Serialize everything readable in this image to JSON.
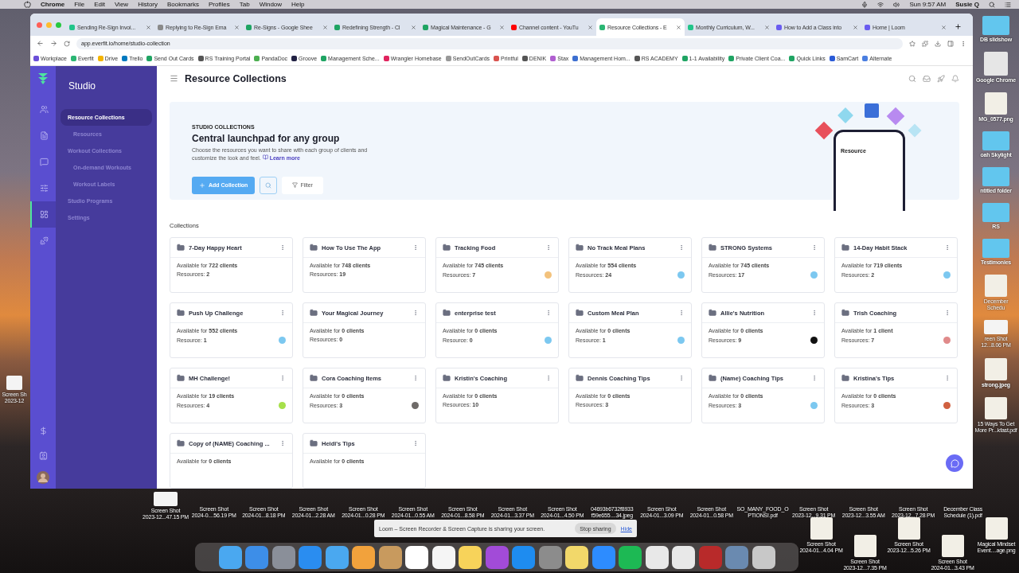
{
  "menubar": {
    "app": "Chrome",
    "menus": [
      "File",
      "Edit",
      "View",
      "History",
      "Bookmarks",
      "Profiles",
      "Tab",
      "Window",
      "Help"
    ],
    "clock": "Sun 9:57 AM",
    "user": "Susie Q"
  },
  "browser": {
    "tabs": [
      {
        "title": "Sending Re-Sign Invoi...",
        "color": "#22c58a",
        "selected": false
      },
      {
        "title": "Replying to Re-Sign Ema",
        "color": "#8a8a8a",
        "selected": false
      },
      {
        "title": "Re-Signs - Google Shee",
        "color": "#1fa463",
        "selected": false
      },
      {
        "title": "Redefining Strength - Cl",
        "color": "#1fa463",
        "selected": false
      },
      {
        "title": "Magical Maintenance - G",
        "color": "#1fa463",
        "selected": false
      },
      {
        "title": "Channel content - YouTu",
        "color": "#ff0000",
        "selected": false
      },
      {
        "title": "Resource Collections - E",
        "color": "#2bb673",
        "selected": true
      },
      {
        "title": "Monthly Curriculum, W...",
        "color": "#22c58a",
        "selected": false
      },
      {
        "title": "How to Add a Class into",
        "color": "#6a5cf0",
        "selected": false
      },
      {
        "title": "Home | Loom",
        "color": "#6a5cf0",
        "selected": false
      }
    ],
    "address": "app.everfit.io/home/studio-collection",
    "bookmarks": [
      {
        "label": "Workplace",
        "color": "#6b4fd8"
      },
      {
        "label": "Everfit",
        "color": "#2bb673"
      },
      {
        "label": "Drive",
        "color": "#f4b400"
      },
      {
        "label": "Trello",
        "color": "#0079bf"
      },
      {
        "label": "Send Out Cards",
        "color": "#1fa463"
      },
      {
        "label": "RS Training Portal",
        "color": "#555555"
      },
      {
        "label": "PandaDoc",
        "color": "#4caf50"
      },
      {
        "label": "Groove",
        "color": "#222244"
      },
      {
        "label": "Management Sche...",
        "color": "#1fa463"
      },
      {
        "label": "Wrangler Homebase",
        "color": "#e0245e"
      },
      {
        "label": "SendOutCards",
        "color": "#999999"
      },
      {
        "label": "Printful",
        "color": "#d9534f"
      },
      {
        "label": "DENIK",
        "color": "#555555"
      },
      {
        "label": "Stax",
        "color": "#b05fd0"
      },
      {
        "label": "Management Hom...",
        "color": "#3d6fd0"
      },
      {
        "label": "RS ACADEMY",
        "color": "#555555"
      },
      {
        "label": "1-1 Availability",
        "color": "#1fa463"
      },
      {
        "label": "Private Client Coa...",
        "color": "#1fa463"
      },
      {
        "label": "Quick Links",
        "color": "#1fa463"
      },
      {
        "label": "SamCart",
        "color": "#2a5bd7"
      },
      {
        "label": "Alternate",
        "color": "#4a7ee0"
      }
    ]
  },
  "app": {
    "rail": [
      {
        "selected": false
      },
      {
        "selected": false
      },
      {
        "selected": false
      },
      {
        "selected": false
      },
      {
        "selected": true
      },
      {
        "selected": false
      }
    ],
    "section": "Studio",
    "menu": [
      {
        "label": "Resource Collections",
        "kind": "main",
        "selected": true
      },
      {
        "label": "Resources",
        "kind": "sub",
        "selected": false
      },
      {
        "label": "Workout Collections",
        "kind": "main",
        "selected": false
      },
      {
        "label": "On-demand Workouts",
        "kind": "sub",
        "selected": false
      },
      {
        "label": "Workout Labels",
        "kind": "sub",
        "selected": false
      },
      {
        "label": "Studio Programs",
        "kind": "main",
        "selected": false
      },
      {
        "label": "Settings",
        "kind": "main",
        "selected": false
      }
    ],
    "title": "Resource Collections",
    "banner": {
      "eyebrow": "STUDIO COLLECTIONS",
      "heading": "Central launchpad for any group",
      "text": "Choose the resources you want to share with each group of clients and customize the look and feel.",
      "link": "Learn more",
      "add": "Add Collection",
      "filter": "Filter",
      "screen_title": "Resource"
    },
    "collections_label": "Collections",
    "cards": [
      {
        "name": "7-Day Happy Heart",
        "available": "Available for **722 clients**",
        "resources": "Resources: **2**"
      },
      {
        "name": "How To Use The App",
        "available": "Available for **748 clients**",
        "resources": "Resources: **19**"
      },
      {
        "name": "Tracking Food",
        "available": "Available for **745 clients**",
        "resources": "Resources: **7**",
        "color": "#f3c27c"
      },
      {
        "name": "No Track Meal Plans",
        "available": "Available for **554 clients**",
        "resources": "Resources: **24**",
        "color": "#7cc8f0"
      },
      {
        "name": "STRONG Systems",
        "available": "Available for **745 clients**",
        "resources": "Resources: **17**",
        "color": "#7cc8f0"
      },
      {
        "name": "14-Day Habit Stack",
        "available": "Available for **719 clients**",
        "resources": "Resources: **2**",
        "color": "#7cc8f0"
      },
      {
        "name": "Push Up Challenge",
        "available": "Available for **552 clients**",
        "resources": "Resource: **1**",
        "color": "#7cc8f0"
      },
      {
        "name": "Your Magical Journey",
        "available": "Available for **0 clients**",
        "resources": "Resources: **0**"
      },
      {
        "name": "enterprise test",
        "available": "Available for **0 clients**",
        "resources": "Resource: **0**",
        "color": "#7cc8f0"
      },
      {
        "name": "Custom Meal Plan",
        "available": "Available for **0 clients**",
        "resources": "Resource: **1**",
        "color": "#7cc8f0"
      },
      {
        "name": "Allie's Nutrition",
        "available": "Available for **0 clients**",
        "resources": "Resources: **9**",
        "color": "#111111"
      },
      {
        "name": "Trish Coaching",
        "available": "Available for **1 client**",
        "resources": "Resources: **7**",
        "color": "#e08a8a"
      },
      {
        "name": "MH Challenge!",
        "available": "Available for **19 clients**",
        "resources": "Resources: **4**",
        "color": "#a6e04a"
      },
      {
        "name": "Cora Coaching Items",
        "available": "Available for **0 clients**",
        "resources": "Resources: **3**",
        "color": "#6e6a68"
      },
      {
        "name": "Kristin's Coaching",
        "available": "Available for **0 clients**",
        "resources": "Resources: **10**"
      },
      {
        "name": "Dennis Coaching Tips",
        "available": "Available for **0 clients**",
        "resources": "Resources: **3**"
      },
      {
        "name": "(Name) Coaching Tips",
        "available": "Available for **0 clients**",
        "resources": "Resources: **3**",
        "color": "#7cc8f0"
      },
      {
        "name": "Kristina's Tips",
        "available": "Available for **0 clients**",
        "resources": "Resources: **3**",
        "color": "#d06040"
      },
      {
        "name": "Copy of (NAME) Coaching ...",
        "available": "Available for **0 clients**"
      },
      {
        "name": "Heidi's Tips",
        "available": "Available for **0 clients**"
      }
    ]
  },
  "desktop": {
    "right_column": [
      {
        "lines": [
          "DB slidshow"
        ],
        "kind": "folder"
      },
      {
        "lines": [
          "Google Chrome"
        ],
        "kind": "drive"
      },
      {
        "lines": [
          "MG_0577.png"
        ],
        "kind": "image"
      },
      {
        "lines": [
          "oah Skylight"
        ],
        "kind": "folder"
      },
      {
        "lines": [
          "ntitled folder"
        ],
        "kind": "folder"
      },
      {
        "lines": [
          "RS"
        ],
        "kind": "folder"
      },
      {
        "lines": [
          "Testimonies"
        ],
        "kind": "folder"
      },
      {
        "lines": [
          "December",
          "Schedu"
        ],
        "kind": "image"
      },
      {
        "lines": [
          "reen Shot",
          "12...8.06 PM"
        ],
        "kind": "shot"
      },
      {
        "lines": [
          "strong.jpeg"
        ],
        "kind": "image"
      },
      {
        "lines": [
          "15 Ways To Get",
          "More Pr...kfast.pdf"
        ],
        "kind": "image"
      }
    ],
    "left_items": [
      {
        "lines": [
          "Screen Sh",
          "2023-12"
        ],
        "kind": "shot"
      },
      {
        "lines": [
          "Screen Shot",
          "2023-12...47.15 PM"
        ],
        "kind": "shot"
      }
    ],
    "bottom_row": [
      {
        "lines": [
          "Screen Shot",
          "2024-0....56.19 PM"
        ]
      },
      {
        "lines": [
          "Screen Shot",
          "2024-01...8.18 PM"
        ]
      },
      {
        "lines": [
          "Screen Shot",
          "2024-01...2.28 AM"
        ]
      },
      {
        "lines": [
          "Screen Shot",
          "2024-01...0.28 PM"
        ]
      },
      {
        "lines": [
          "Screen Shot",
          "2024-01...0.55 AM"
        ]
      },
      {
        "lines": [
          "Screen Shot",
          "2024-01...8.58 PM"
        ]
      },
      {
        "lines": [
          "Screen Shot",
          "2024-01...3.37 PM"
        ]
      },
      {
        "lines": [
          "Screen Shot",
          "2024-01...4.50 PM"
        ]
      },
      {
        "lines": [
          "04693b6732f8933",
          "f59e655....34.jpeg"
        ]
      },
      {
        "lines": [
          "Screen Shot",
          "2024-01...3.09 PM"
        ]
      },
      {
        "lines": [
          "Screen Shot",
          "2024-01...0.58 PM"
        ]
      },
      {
        "lines": [
          "SO_MANY_FOOD_O",
          "PTIONS!.pdf"
        ]
      },
      {
        "lines": [
          "Screen Shot",
          "2023-12...9.31 PM"
        ]
      },
      {
        "lines": [
          "Screen Shot",
          "2023-12...3.55 AM"
        ]
      },
      {
        "lines": [
          "Screen Shot",
          "2023-12...7.28 PM"
        ]
      },
      {
        "lines": [
          "December Class",
          "Schedule (1).pdf"
        ]
      }
    ],
    "lower_right": [
      {
        "lines": [
          "Screen Shot",
          "2024-01...4.04 PM"
        ]
      },
      {
        "lines": [
          "Screen Shot",
          "2023-12...7.35 PM"
        ]
      },
      {
        "lines": [
          "Screen Shot",
          "2023-12...5.26 PM"
        ]
      },
      {
        "lines": [
          "Screen Shot",
          "2024-01...3.43 PM"
        ]
      },
      {
        "lines": [
          "Magical Mindset",
          "Event....age.png"
        ]
      }
    ]
  },
  "loom": {
    "text": "Loom – Screen Recorder & Screen Capture is sharing your screen.",
    "stop": "Stop sharing",
    "hide": "Hide"
  },
  "dock": [
    {
      "color": "#4aa8f0"
    },
    {
      "color": "#3d8ee8"
    },
    {
      "color": "#8a8f99"
    },
    {
      "color": "#2a8df0"
    },
    {
      "color": "#4aa8f0"
    },
    {
      "color": "#f2a23c"
    },
    {
      "color": "#c89a5e"
    },
    {
      "color": "#ffffff"
    },
    {
      "color": "#f5f5f5"
    },
    {
      "color": "#f7d35a"
    },
    {
      "color": "#a24bd8"
    },
    {
      "color": "#1e8cf0"
    },
    {
      "color": "#8c8c8c"
    },
    {
      "color": "#f2d86a"
    },
    {
      "color": "#2d8cff"
    },
    {
      "color": "#1db954"
    },
    {
      "color": "#e8e8e8"
    },
    {
      "color": "#e8e8e8"
    },
    {
      "color": "#b82a2a"
    },
    {
      "color": "#6a8ab0"
    },
    {
      "color": "#c8c8c8"
    }
  ]
}
